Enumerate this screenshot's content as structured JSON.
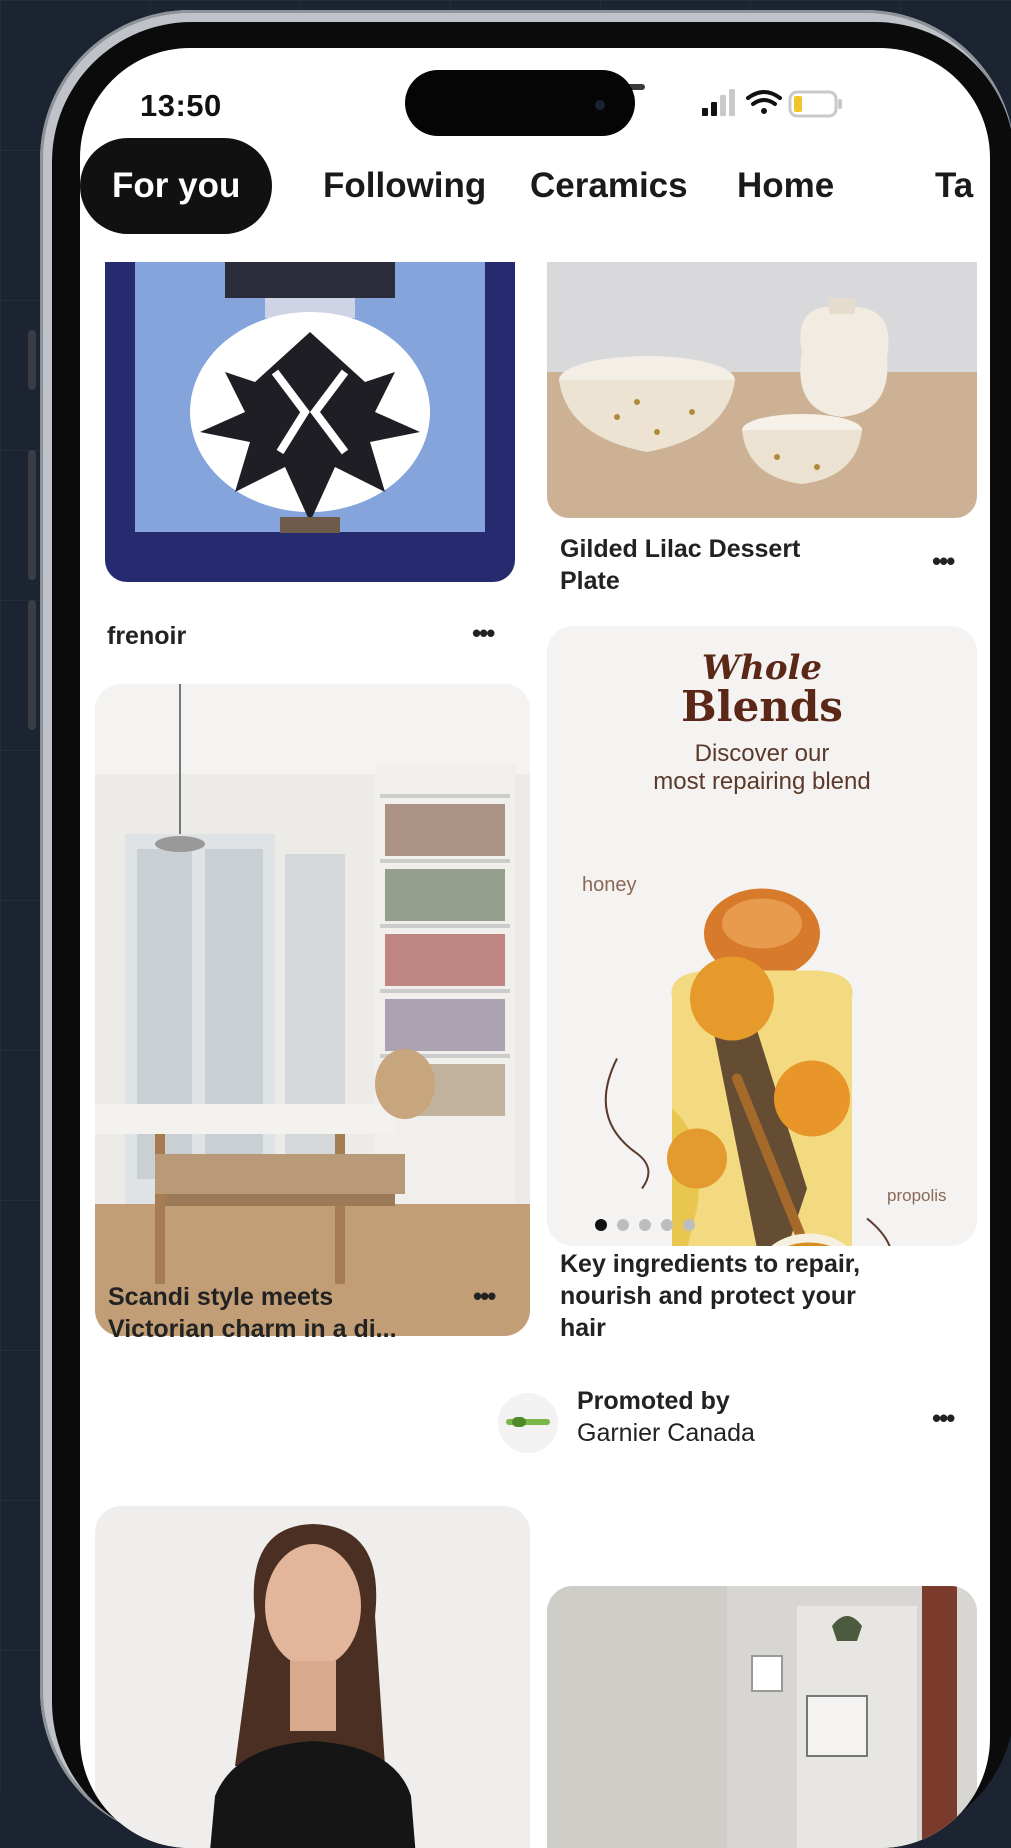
{
  "status": {
    "time": "13:50"
  },
  "tabs": [
    {
      "label": "For you",
      "active": true
    },
    {
      "label": "Following",
      "active": false
    },
    {
      "label": "Ceramics",
      "active": false
    },
    {
      "label": "Home",
      "active": false
    },
    {
      "label": "Ta",
      "active": false
    }
  ],
  "pins": {
    "art": {
      "title": "frenoir"
    },
    "bowls": {
      "title_line1": "Gilded Lilac Dessert",
      "title_line2": "Plate"
    },
    "room": {
      "title_line1": "Scandi style meets",
      "title_line2": "Victorian charm in a di..."
    },
    "ad": {
      "brand_line1": "Whole",
      "brand_line2": "Blends",
      "subtitle_line1": "Discover our",
      "subtitle_line2": "most repairing blend",
      "label_honey": "honey",
      "label_propolis": "propolis",
      "title_line1": "Key ingredients to repair,",
      "title_line2": "nourish and protect your",
      "title_line3": "hair",
      "promoted_label": "Promoted by",
      "advertiser": "Garnier Canada",
      "carousel_count": 5,
      "carousel_index": 0
    }
  },
  "more_label": "•••",
  "colors": {
    "active_tab": "#111111",
    "brand_text": "#5b2717",
    "background": "#1c2431"
  }
}
